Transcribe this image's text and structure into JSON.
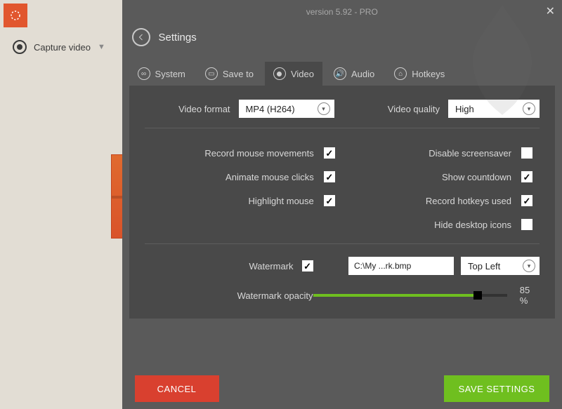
{
  "version_line": "version 5.92 - PRO",
  "sidebar": {
    "capture_label": "Capture video"
  },
  "header": {
    "title": "Settings"
  },
  "tabs": {
    "system": "System",
    "save_to": "Save to",
    "video": "Video",
    "audio": "Audio",
    "hotkeys": "Hotkeys"
  },
  "video": {
    "format_label": "Video format",
    "format_value": "MP4 (H264)",
    "quality_label": "Video quality",
    "quality_value": "High",
    "opts_left": {
      "record_mouse": "Record mouse movements",
      "animate_clicks": "Animate mouse clicks",
      "highlight_mouse": "Highlight mouse"
    },
    "opts_right": {
      "disable_ss": "Disable screensaver",
      "show_countdown": "Show countdown",
      "record_hotkeys": "Record hotkeys used",
      "hide_icons": "Hide desktop icons"
    },
    "watermark_label": "Watermark",
    "watermark_path": "C:\\My ...rk.bmp",
    "watermark_pos": "Top Left",
    "opacity_label": "Watermark opacity",
    "opacity_value": 85,
    "opacity_text": "85 %"
  },
  "buttons": {
    "cancel": "CANCEL",
    "save": "SAVE SETTINGS"
  },
  "state": {
    "record_mouse": true,
    "animate_clicks": true,
    "highlight_mouse": true,
    "disable_ss": false,
    "show_countdown": true,
    "record_hotkeys": true,
    "hide_icons": false,
    "watermark": true
  }
}
